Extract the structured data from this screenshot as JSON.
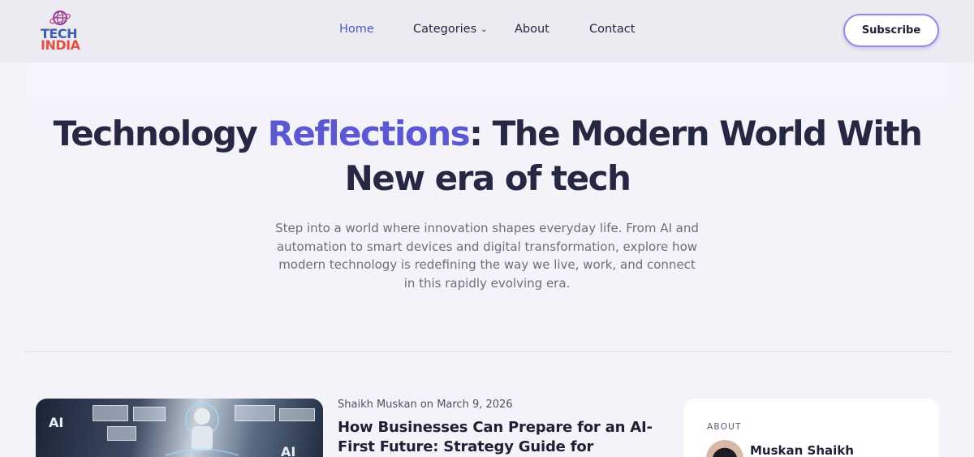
{
  "brand": {
    "logo_line1": "TECH",
    "logo_line2": "INDIA",
    "color_primary": "#3b5fae",
    "color_secondary": "#e2503f"
  },
  "nav": {
    "items": [
      {
        "label": "Home",
        "active": true
      },
      {
        "label": "Categories",
        "has_dropdown": true
      },
      {
        "label": "About"
      },
      {
        "label": "Contact"
      }
    ],
    "subscribe_label": "Subscribe",
    "accent": "#5553c8"
  },
  "hero": {
    "title_part1": "Technology ",
    "title_accent": "Reflections",
    "title_part2": ": The Modern World With New era of tech",
    "description": "Step into a world where innovation shapes everyday life. From AI and automation to smart devices and digital transformation, explore how modern technology is redefining the way we live, work, and connect in this rapidly evolving era."
  },
  "post": {
    "author": "Shaikh Muskan",
    "date_prefix": "on",
    "date": "March 9, 2026",
    "title": "How Businesses Can Prepare for an AI-First Future: Strategy Guide for",
    "image_text": "AI"
  },
  "about": {
    "label": "ABOUT",
    "name": "Muskan Shaikh"
  }
}
